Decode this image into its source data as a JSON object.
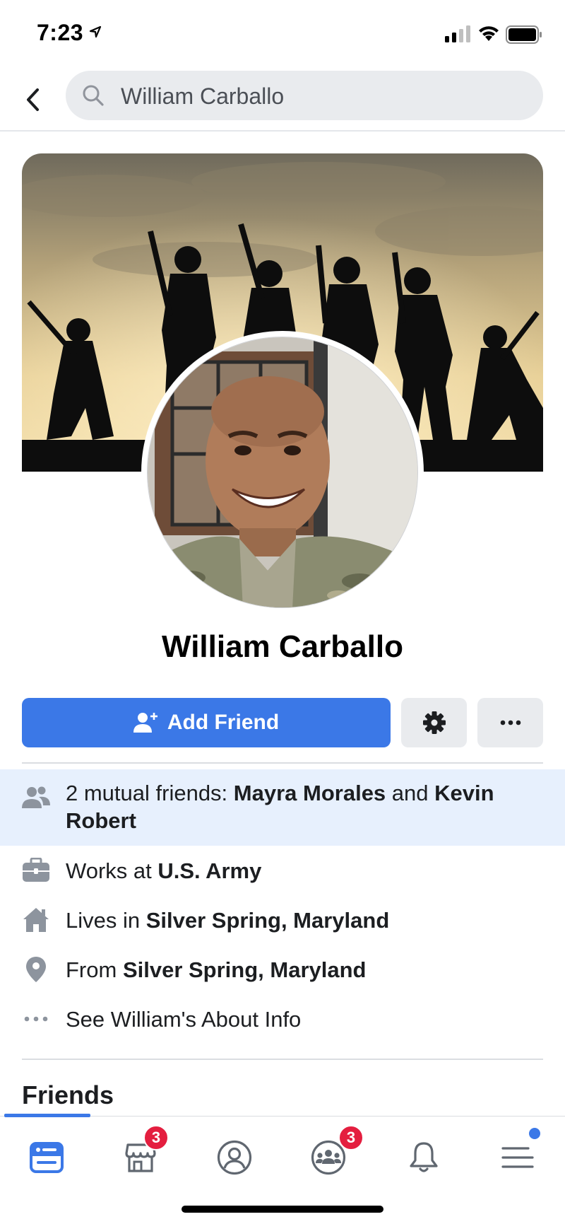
{
  "status_bar": {
    "time": "7:23"
  },
  "search": {
    "query": "William Carballo"
  },
  "profile": {
    "name": "William Carballo",
    "add_friend_label": "Add Friend"
  },
  "mutual": {
    "prefix": "2 mutual friends: ",
    "friend1": "Mayra Morales",
    "conjunction": " and ",
    "friend2": "Kevin Robert"
  },
  "info": {
    "work_prefix": "Works at ",
    "work_value": "U.S. Army",
    "lives_prefix": "Lives in ",
    "lives_value": "Silver Spring, Maryland",
    "from_prefix": "From ",
    "from_value": "Silver Spring, Maryland",
    "about_label": "See William's About Info"
  },
  "friends_section": {
    "title": "Friends"
  },
  "bottom_nav": {
    "marketplace_badge": "3",
    "groups_badge": "3"
  },
  "colors": {
    "accent": "#3b78e7",
    "badge": "#e41e3f",
    "highlight_row": "#e7f0fd",
    "button_gray": "#e9ebee"
  }
}
